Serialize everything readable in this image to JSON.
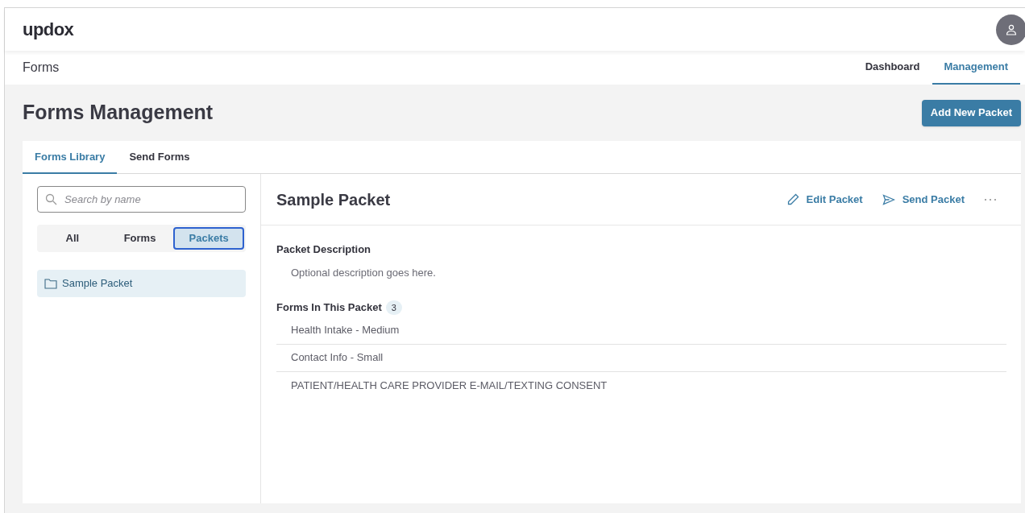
{
  "header": {
    "logo": "updox"
  },
  "subnav": {
    "title": "Forms",
    "links": [
      {
        "label": "Dashboard",
        "selected": false
      },
      {
        "label": "Management",
        "selected": true
      }
    ]
  },
  "page": {
    "title": "Forms Management",
    "primary_button": "Add New Packet"
  },
  "tabs": [
    {
      "label": "Forms Library",
      "selected": true
    },
    {
      "label": "Send Forms",
      "selected": false
    }
  ],
  "sidebar": {
    "search": {
      "placeholder": "Search by name"
    },
    "filters": [
      {
        "label": "All",
        "selected": false
      },
      {
        "label": "Forms",
        "selected": false
      },
      {
        "label": "Packets",
        "selected": true
      }
    ],
    "items": [
      {
        "label": "Sample Packet",
        "selected": true
      }
    ]
  },
  "detail": {
    "title": "Sample Packet",
    "actions": [
      {
        "kind": "edit",
        "label": "Edit Packet"
      },
      {
        "kind": "send",
        "label": "Send Packet"
      },
      {
        "kind": "more"
      }
    ],
    "description_label": "Packet Description",
    "description": "Optional description goes here.",
    "forms_label": "Forms In This Packet",
    "forms_count": "3",
    "forms": [
      "Health Intake - Medium",
      "Contact Info - Small",
      "PATIENT/HEALTH CARE PROVIDER E-MAIL/TEXTING CONSENT"
    ]
  }
}
